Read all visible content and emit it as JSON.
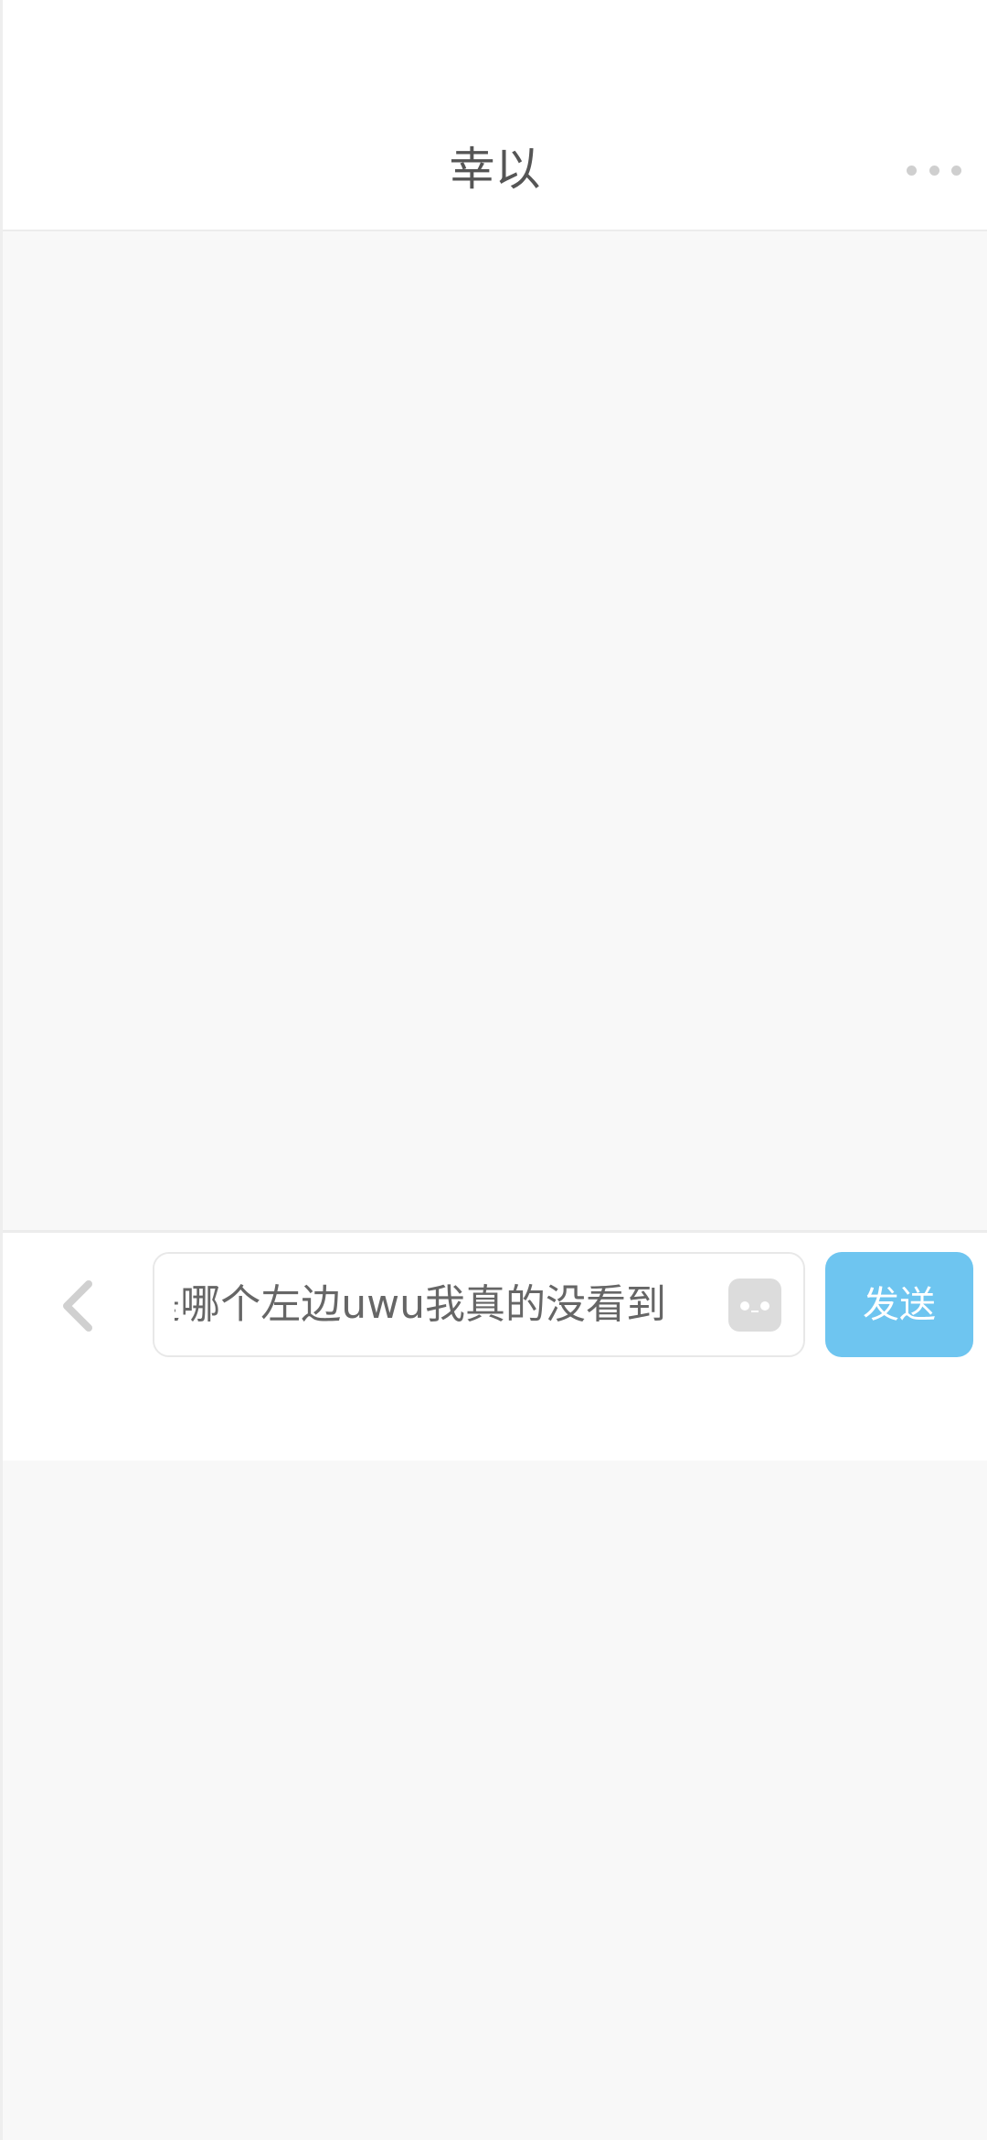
{
  "header": {
    "title": "幸以",
    "more_icon": "more-horizontal-icon"
  },
  "composer": {
    "back_icon": "chevron-left-icon",
    "input_value": "是哪个左边uwu我真的没看到",
    "emoji_icon": "emoji-face-icon",
    "send_label": "发送"
  },
  "colors": {
    "accent": "#6ec5f0",
    "background": "#f8f8f8",
    "surface": "#ffffff"
  }
}
